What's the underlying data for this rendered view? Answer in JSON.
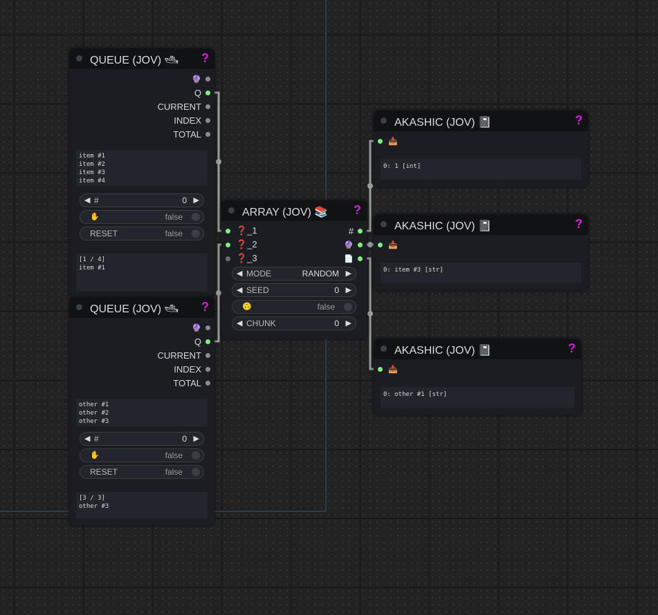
{
  "queue1": {
    "title": "QUEUE (JOV) 🛥",
    "help": "?",
    "outputs": {
      "any_icon": "🔮",
      "q": "Q",
      "current": "CURRENT",
      "index": "INDEX",
      "total": "TOTAL"
    },
    "text_lines": [
      "item #1",
      "item #2",
      "item #3",
      "item #4"
    ],
    "widgets": {
      "index_label": "#",
      "index_value": "0",
      "hold_icon": "✋",
      "hold_value": "false",
      "reset_label": "RESET",
      "reset_value": "false"
    },
    "status_lines": [
      "[1 / 4]",
      "item #1"
    ]
  },
  "queue2": {
    "title": "QUEUE (JOV) 🛥",
    "help": "?",
    "outputs": {
      "any_icon": "🔮",
      "q": "Q",
      "current": "CURRENT",
      "index": "INDEX",
      "total": "TOTAL"
    },
    "text_lines": [
      "other #1",
      "other #2",
      "other #3"
    ],
    "widgets": {
      "index_label": "#",
      "index_value": "0",
      "hold_icon": "✋",
      "hold_value": "false",
      "reset_label": "RESET",
      "reset_value": "false"
    },
    "status_lines": [
      "[3 / 3]",
      "other #3"
    ]
  },
  "array": {
    "title": "ARRAY (JOV) 📚",
    "help": "?",
    "inputs": [
      "❓_1",
      "❓_2",
      "❓_3"
    ],
    "outputs": {
      "count": "#",
      "any_icon": "🔮",
      "list_icon": "📄"
    },
    "widgets": {
      "mode_label": "MODE",
      "mode_value": "RANDOM",
      "seed_label": "SEED",
      "seed_value": "0",
      "flip_icon": "🙃",
      "flip_value": "false",
      "chunk_label": "CHUNK",
      "chunk_value": "0"
    }
  },
  "akashic1": {
    "title": "AKASHIC (JOV) 📓",
    "help": "?",
    "input_icon": "📥",
    "value": "0: 1 [int]"
  },
  "akashic2": {
    "title": "AKASHIC (JOV) 📓",
    "help": "?",
    "input_icon": "📥",
    "value": "0: item #3 [str]"
  },
  "akashic3": {
    "title": "AKASHIC (JOV) 📓",
    "help": "?",
    "input_icon": "📥",
    "value": "0: other #1 [str]"
  },
  "colors": {
    "canvas": "#222222",
    "node_body": "#1b1d22",
    "node_header": "#111214",
    "link": "#9a9f9a",
    "slot_connected": "#7df07d",
    "help": "#d61fd6"
  }
}
